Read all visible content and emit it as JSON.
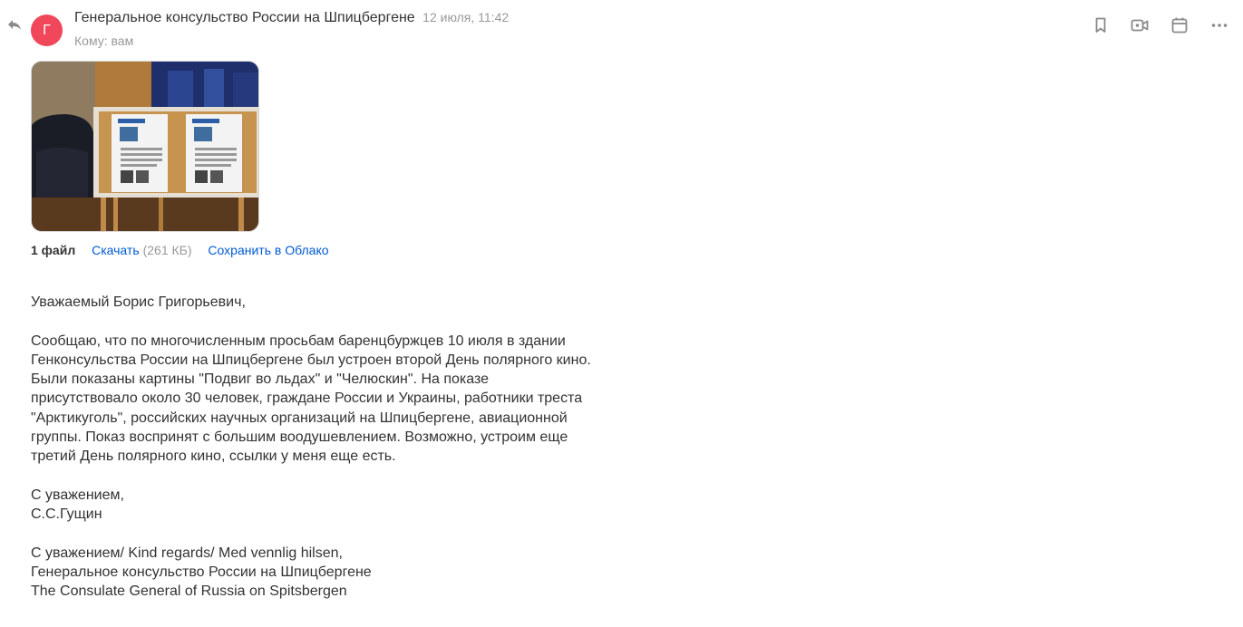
{
  "header": {
    "avatar_letter": "Г",
    "sender": "Генеральное консульство России на Шпицбергене",
    "date": "12 июля, 11:42",
    "to_label": "Кому:",
    "to_value": "вам"
  },
  "toolbar": {
    "icons": [
      "bookmark-icon",
      "video-call-icon",
      "calendar-icon",
      "more-icon"
    ]
  },
  "attachment": {
    "count": "1 файл",
    "download": "Скачать",
    "size": "(261 КБ)",
    "save_cloud": "Сохранить в Облако"
  },
  "body": {
    "greeting": "Уважаемый Борис Григорьевич,",
    "paragraph": [
      "Сообщаю, что по многочисленным просьбам баренцбуржцев 10 июля в здании",
      "Генконсульства России на Шпицбергене был устроен второй День полярного кино.",
      "Были показаны картины \"Подвиг во льдах\" и \"Челюскин\". На показе",
      "присутствовало около 30 человек, граждане России и Украины, работники треста",
      "\"Арктикуголь\", российских научных организаций на Шпицбергене, авиационной",
      "группы. Показ воспринят с большим воодушевлением. Возможно, устроим еще",
      "третий День полярного кино, ссылки у меня еще есть."
    ],
    "regards": "С уважением,",
    "signer": "С.С.Гущин",
    "signature": [
      "С уважением/ Kind regards/ Med vennlig hilsen,",
      "Генеральное консульство России на Шпицбергене",
      "The Consulate General of Russia on Spitsbergen"
    ]
  },
  "colors": {
    "avatar": "#f0475a",
    "link": "#005bd1",
    "muted": "#999999",
    "text": "#333333"
  }
}
